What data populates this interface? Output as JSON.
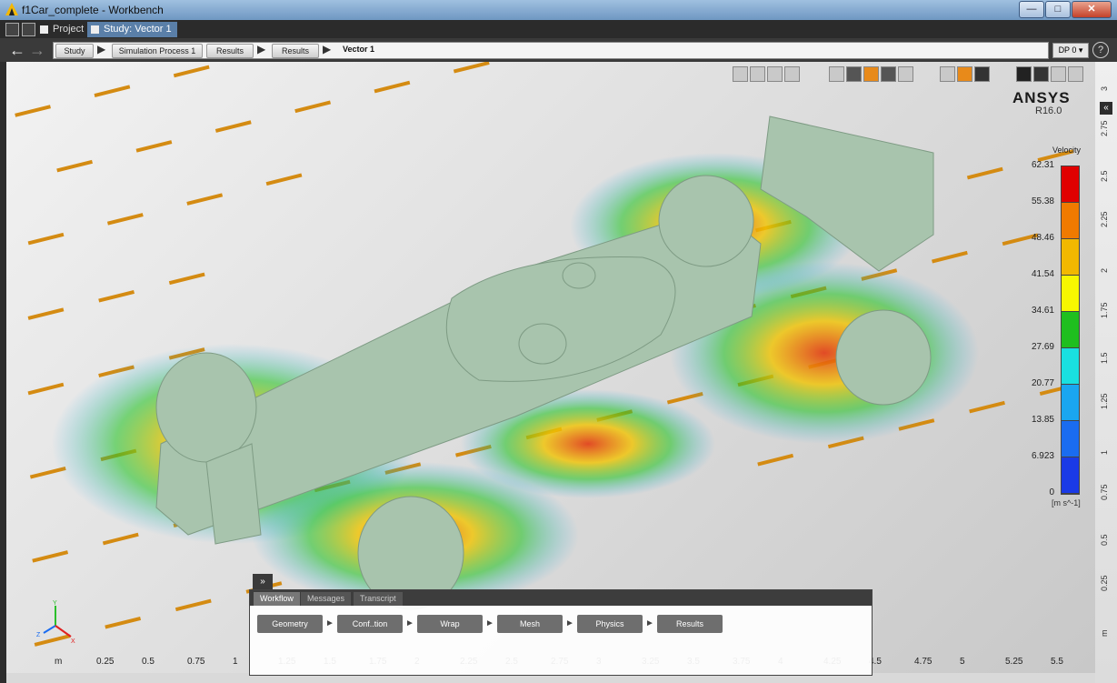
{
  "window": {
    "title": "f1Car_complete - Workbench",
    "minimize": "—",
    "maximize": "□",
    "close": "✕"
  },
  "tabs": [
    {
      "label": "Project"
    },
    {
      "label": "Study: Vector 1"
    }
  ],
  "breadcrumb": [
    "Study",
    "Simulation Process 1",
    "Results",
    "Results",
    "Vector 1"
  ],
  "dp": "DP 0 ▾",
  "help": "?",
  "expand": "»",
  "collapse": "«",
  "brand": {
    "name": "ANSYS",
    "release": "R16.0"
  },
  "legend": {
    "title": "Velocity",
    "units": "[m s^-1]",
    "values": [
      "62.31",
      "55.38",
      "48.46",
      "41.54",
      "34.61",
      "27.69",
      "20.77",
      "13.85",
      "6.923",
      "0"
    ],
    "colors": [
      "#e00000",
      "#f07a00",
      "#f2b800",
      "#f7f700",
      "#1fbf1f",
      "#19e0e0",
      "#1aa6f0",
      "#1a6cf0",
      "#1a3ae6"
    ]
  },
  "x_axis": {
    "unit": "m",
    "ticks": [
      "0.25",
      "0.5",
      "0.75",
      "1",
      "1.25",
      "1.5",
      "1.75",
      "2",
      "2.25",
      "2.5",
      "2.75",
      "3",
      "3.25",
      "3.5",
      "3.75",
      "4",
      "4.25",
      "4.5",
      "4.75",
      "5",
      "5.25",
      "5.5"
    ]
  },
  "y_axis": {
    "ticks": [
      "3",
      "2.75",
      "2.5",
      "2.25",
      "2",
      "1.75",
      "1.5",
      "1.25",
      "1",
      "0.75",
      "0.5",
      "0.25",
      "m"
    ]
  },
  "bottom_panel": {
    "toggle": "»",
    "tabs": [
      "Workflow",
      "Messages",
      "Transcript"
    ],
    "workflow": [
      "Geometry",
      "Conf..tion",
      "Wrap",
      "Mesh",
      "Physics",
      "Results"
    ]
  }
}
